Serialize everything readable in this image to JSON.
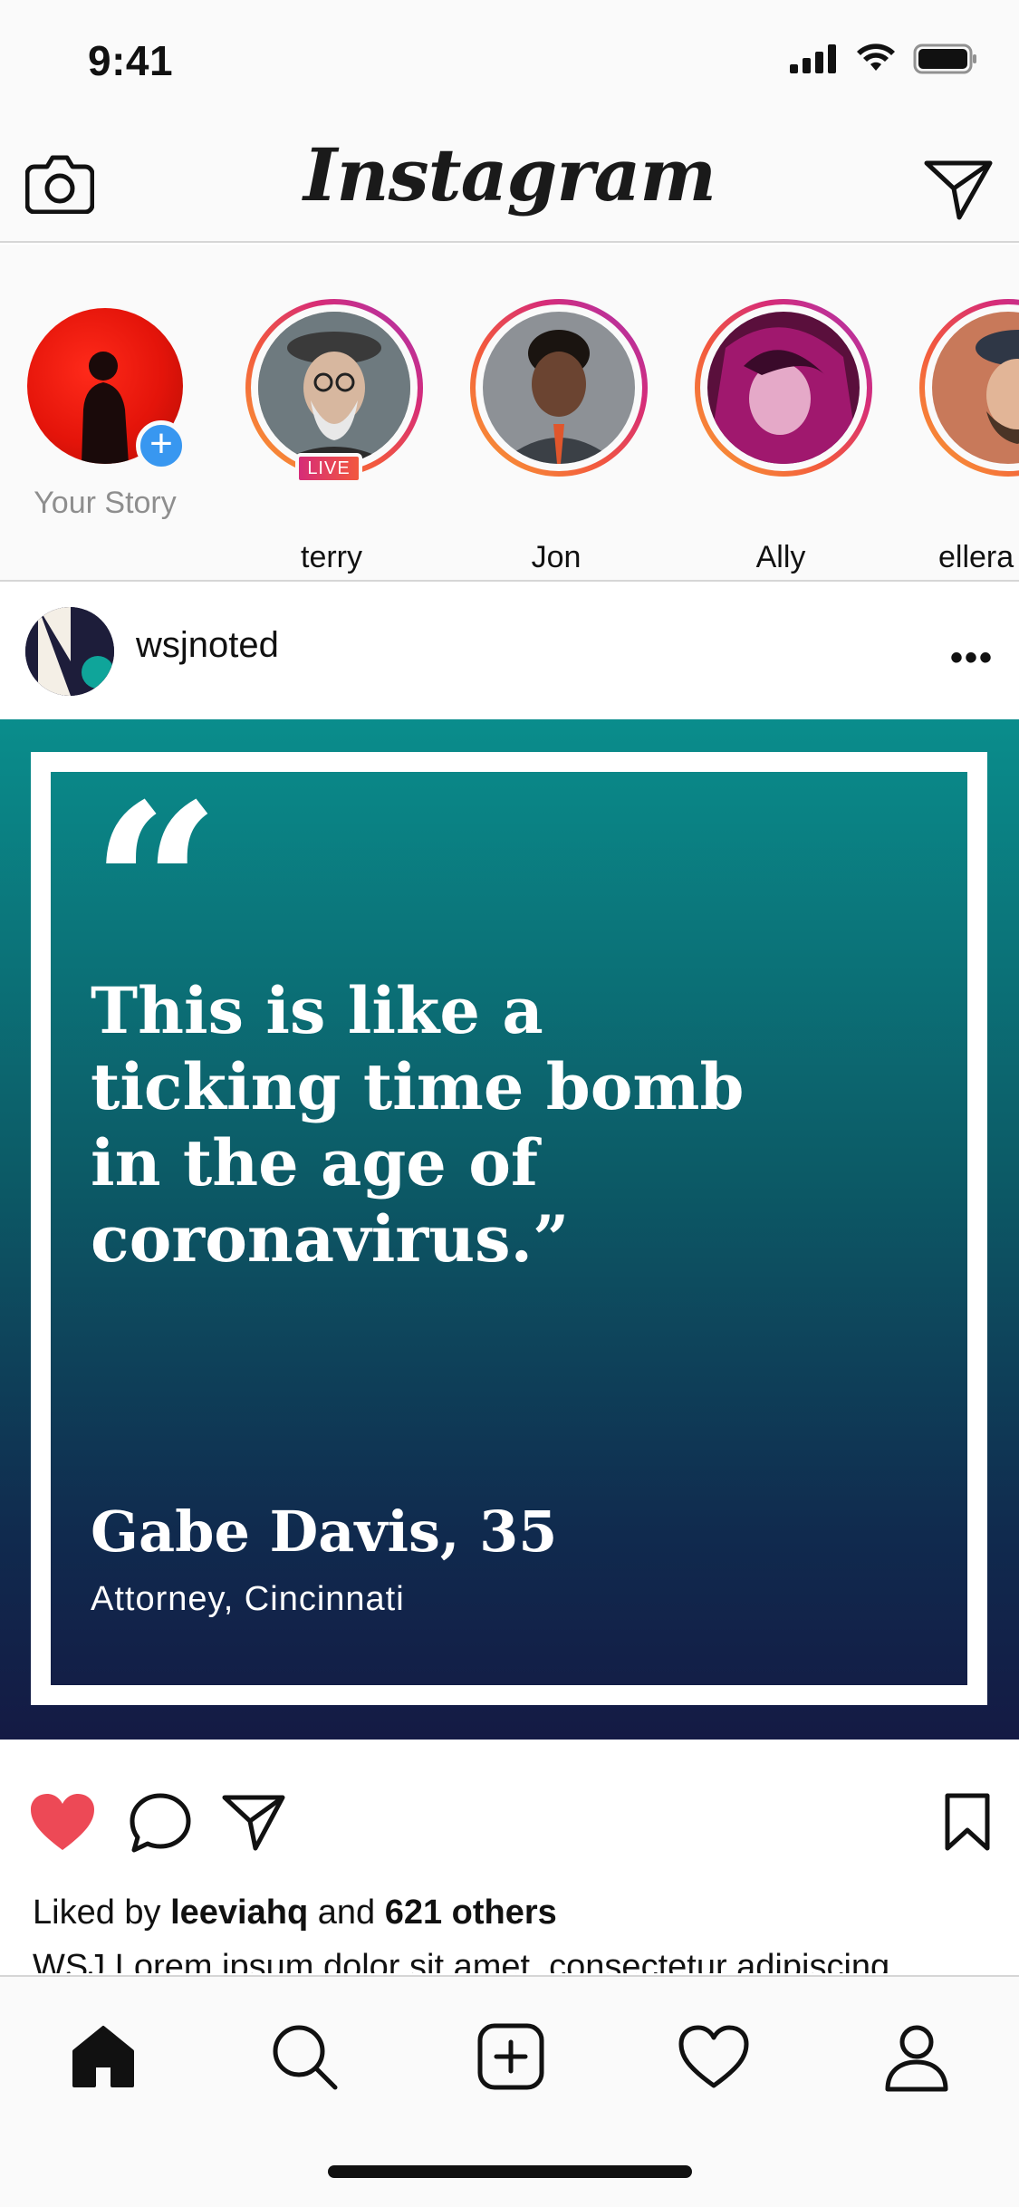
{
  "status_bar": {
    "time": "9:41"
  },
  "header": {
    "logo": "Instagram"
  },
  "stories": [
    {
      "name": "Your Story",
      "own": true
    },
    {
      "name": "terry",
      "live": true
    },
    {
      "name": "Jon"
    },
    {
      "name": "Ally"
    },
    {
      "name": "ellera"
    }
  ],
  "live_label": "LIVE",
  "post": {
    "username": "wsjnoted",
    "more_label": "•••",
    "quote_marks": "“",
    "quote": "This is like a ticking time bomb in the age of coronavirus.”",
    "quote_name": "Gabe Davis, 35",
    "quote_role": "Attorney, Cincinnati",
    "liked_prefix": "Liked by ",
    "liked_user": "leeviahq",
    "liked_mid": " and ",
    "liked_others": "621 others",
    "caption": "WSJ Lorem ipsum dolor sit amet, consectetur adipiscing"
  },
  "colors": {
    "accent_blue": "#3897f0",
    "like_red": "#ed4956",
    "post_teal": "#0a8d8c",
    "post_navy": "#141a44"
  }
}
